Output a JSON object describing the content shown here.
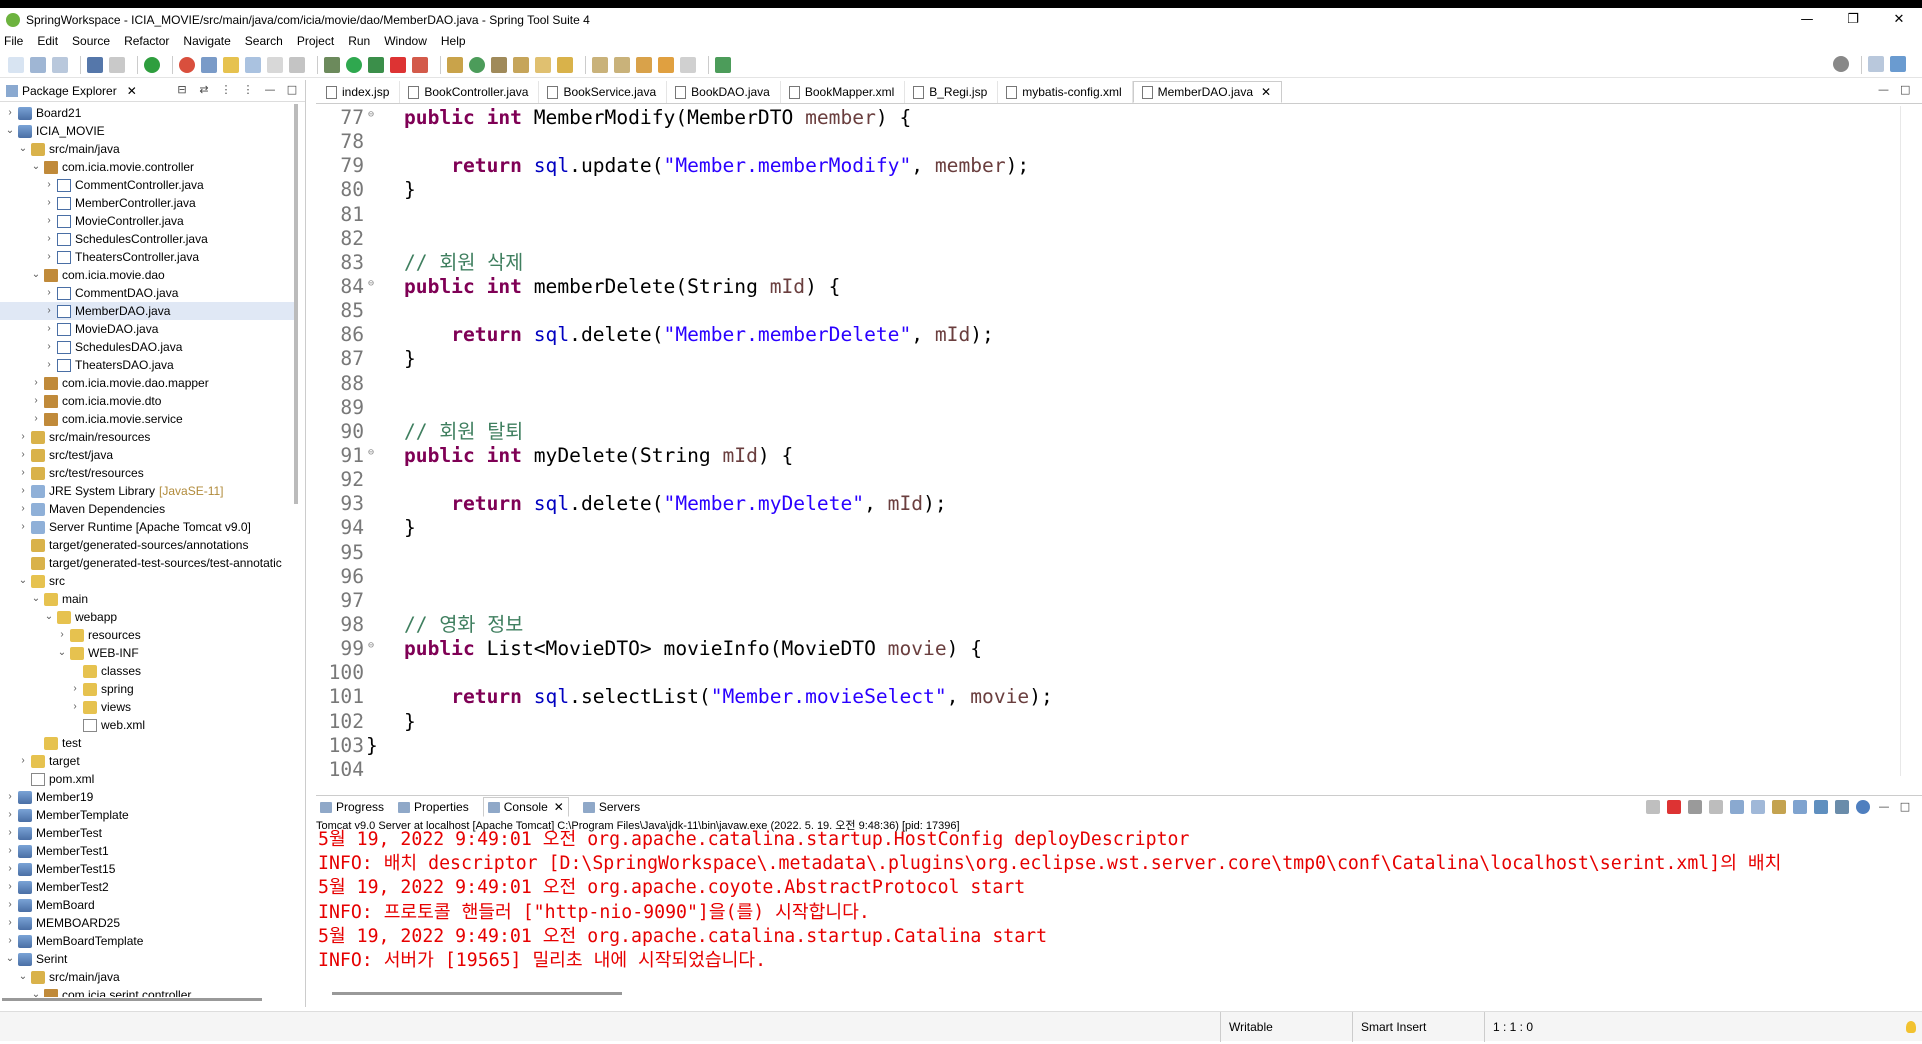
{
  "window": {
    "title": "SpringWorkspace - ICIA_MOVIE/src/main/java/com/icia/movie/dao/MemberDAO.java - Spring Tool Suite 4",
    "controls": [
      "—",
      "❐",
      "✕"
    ]
  },
  "menu": [
    "File",
    "Edit",
    "Source",
    "Refactor",
    "Navigate",
    "Search",
    "Project",
    "Run",
    "Window",
    "Help"
  ],
  "package_explorer": {
    "tab_label": "Package Explorer",
    "tree": [
      {
        "label": "Board21",
        "arrow": "›",
        "icon": "project-icon",
        "indent": 0
      },
      {
        "label": "ICIA_MOVIE",
        "arrow": "⌄",
        "icon": "project-icon",
        "indent": 0
      },
      {
        "label": "src/main/java",
        "arrow": "⌄",
        "icon": "source-folder-icon",
        "indent": 1
      },
      {
        "label": "com.icia.movie.controller",
        "arrow": "⌄",
        "icon": "package-icon",
        "indent": 2
      },
      {
        "label": "CommentController.java",
        "arrow": "›",
        "icon": "java-file-icon",
        "indent": 3
      },
      {
        "label": "MemberController.java",
        "arrow": "›",
        "icon": "java-file-icon",
        "indent": 3
      },
      {
        "label": "MovieController.java",
        "arrow": "›",
        "icon": "java-file-icon",
        "indent": 3
      },
      {
        "label": "SchedulesController.java",
        "arrow": "›",
        "icon": "java-file-icon",
        "indent": 3
      },
      {
        "label": "TheatersController.java",
        "arrow": "›",
        "icon": "java-file-icon",
        "indent": 3
      },
      {
        "label": "com.icia.movie.dao",
        "arrow": "⌄",
        "icon": "package-icon",
        "indent": 2
      },
      {
        "label": "CommentDAO.java",
        "arrow": "›",
        "icon": "java-file-icon",
        "indent": 3
      },
      {
        "label": "MemberDAO.java",
        "arrow": "›",
        "icon": "java-file-icon",
        "indent": 3,
        "selected": true
      },
      {
        "label": "MovieDAO.java",
        "arrow": "›",
        "icon": "java-file-icon",
        "indent": 3
      },
      {
        "label": "SchedulesDAO.java",
        "arrow": "›",
        "icon": "java-file-icon",
        "indent": 3
      },
      {
        "label": "TheatersDAO.java",
        "arrow": "›",
        "icon": "java-file-icon",
        "indent": 3
      },
      {
        "label": "com.icia.movie.dao.mapper",
        "arrow": "›",
        "icon": "package-icon",
        "indent": 2
      },
      {
        "label": "com.icia.movie.dto",
        "arrow": "›",
        "icon": "package-icon",
        "indent": 2
      },
      {
        "label": "com.icia.movie.service",
        "arrow": "›",
        "icon": "package-icon",
        "indent": 2
      },
      {
        "label": "src/main/resources",
        "arrow": "›",
        "icon": "source-folder-icon",
        "indent": 1
      },
      {
        "label": "src/test/java",
        "arrow": "›",
        "icon": "source-folder-icon",
        "indent": 1
      },
      {
        "label": "src/test/resources",
        "arrow": "›",
        "icon": "source-folder-icon",
        "indent": 1
      },
      {
        "label": "JRE System Library",
        "suffix": "[JavaSE-11]",
        "arrow": "›",
        "icon": "library-icon",
        "indent": 1
      },
      {
        "label": "Maven Dependencies",
        "arrow": "›",
        "icon": "library-icon",
        "indent": 1
      },
      {
        "label": "Server Runtime [Apache Tomcat v9.0]",
        "arrow": "›",
        "icon": "library-icon",
        "indent": 1
      },
      {
        "label": "target/generated-sources/annotations",
        "arrow": "",
        "icon": "source-folder-icon",
        "indent": 1
      },
      {
        "label": "target/generated-test-sources/test-annotatic",
        "arrow": "",
        "icon": "source-folder-icon",
        "indent": 1
      },
      {
        "label": "src",
        "arrow": "⌄",
        "icon": "folder-icon",
        "indent": 1
      },
      {
        "label": "main",
        "arrow": "⌄",
        "icon": "folder-icon",
        "indent": 2
      },
      {
        "label": "webapp",
        "arrow": "⌄",
        "icon": "folder-icon",
        "indent": 3
      },
      {
        "label": "resources",
        "arrow": "›",
        "icon": "folder-icon",
        "indent": 4
      },
      {
        "label": "WEB-INF",
        "arrow": "⌄",
        "icon": "folder-icon",
        "indent": 4
      },
      {
        "label": "classes",
        "arrow": "",
        "icon": "folder-icon",
        "indent": 5
      },
      {
        "label": "spring",
        "arrow": "›",
        "icon": "folder-icon",
        "indent": 5
      },
      {
        "label": "views",
        "arrow": "›",
        "icon": "folder-icon",
        "indent": 5
      },
      {
        "label": "web.xml",
        "arrow": "",
        "icon": "xml-file-icon",
        "indent": 5
      },
      {
        "label": "test",
        "arrow": "",
        "icon": "folder-icon",
        "indent": 2
      },
      {
        "label": "target",
        "arrow": "›",
        "icon": "folder-icon",
        "indent": 1
      },
      {
        "label": "pom.xml",
        "arrow": "",
        "icon": "xml-file-icon",
        "indent": 1
      },
      {
        "label": "Member19",
        "arrow": "›",
        "icon": "project-icon",
        "indent": 0
      },
      {
        "label": "MemberTemplate",
        "arrow": "›",
        "icon": "project-icon",
        "indent": 0
      },
      {
        "label": "MemberTest",
        "arrow": "›",
        "icon": "project-icon",
        "indent": 0
      },
      {
        "label": "MemberTest1",
        "arrow": "›",
        "icon": "project-icon",
        "indent": 0
      },
      {
        "label": "MemberTest15",
        "arrow": "›",
        "icon": "project-icon",
        "indent": 0
      },
      {
        "label": "MemberTest2",
        "arrow": "›",
        "icon": "project-icon",
        "indent": 0
      },
      {
        "label": "MemBoard",
        "arrow": "›",
        "icon": "project-icon",
        "indent": 0
      },
      {
        "label": "MEMBOARD25",
        "arrow": "›",
        "icon": "project-icon",
        "indent": 0
      },
      {
        "label": "MemBoardTemplate",
        "arrow": "›",
        "icon": "project-icon",
        "indent": 0
      },
      {
        "label": "Serint",
        "arrow": "⌄",
        "icon": "project-icon",
        "indent": 0
      },
      {
        "label": "src/main/java",
        "arrow": "⌄",
        "icon": "source-folder-icon",
        "indent": 1
      },
      {
        "label": "com.icia.serint.controller",
        "arrow": "⌄",
        "icon": "package-icon",
        "indent": 2
      }
    ]
  },
  "editor": {
    "tabs": [
      {
        "label": "index.jsp"
      },
      {
        "label": "BookController.java"
      },
      {
        "label": "BookService.java"
      },
      {
        "label": "BookDAO.java"
      },
      {
        "label": "BookMapper.xml"
      },
      {
        "label": "B_Regi.jsp"
      },
      {
        "label": "mybatis-config.xml"
      },
      {
        "label": "MemberDAO.java",
        "active": true
      }
    ],
    "lines": [
      {
        "num": "77",
        "fold": true,
        "tokens": [
          [
            "kw",
            "public int "
          ],
          [
            "",
            "MemberModify(MemberDTO "
          ],
          [
            "pv",
            "member"
          ],
          [
            "",
            ") {"
          ]
        ]
      },
      {
        "num": "78",
        "tokens": []
      },
      {
        "num": "79",
        "tokens": [
          [
            "",
            "    "
          ],
          [
            "kw",
            "return "
          ],
          [
            "fld",
            "sql"
          ],
          [
            "",
            ".update("
          ],
          [
            "str",
            "\"Member.memberModify\""
          ],
          [
            "",
            ", "
          ],
          [
            "pv",
            "member"
          ],
          [
            "",
            ");"
          ]
        ]
      },
      {
        "num": "80",
        "tokens": [
          [
            "",
            "}"
          ]
        ]
      },
      {
        "num": "81",
        "tokens": []
      },
      {
        "num": "82",
        "tokens": []
      },
      {
        "num": "83",
        "tokens": [
          [
            "cm",
            "// 회원 삭제"
          ]
        ]
      },
      {
        "num": "84",
        "fold": true,
        "tokens": [
          [
            "kw",
            "public int "
          ],
          [
            "",
            "memberDelete(String "
          ],
          [
            "pv",
            "mId"
          ],
          [
            "",
            ") {"
          ]
        ]
      },
      {
        "num": "85",
        "tokens": []
      },
      {
        "num": "86",
        "tokens": [
          [
            "",
            "    "
          ],
          [
            "kw",
            "return "
          ],
          [
            "fld",
            "sql"
          ],
          [
            "",
            ".delete("
          ],
          [
            "str",
            "\"Member.memberDelete\""
          ],
          [
            "",
            ", "
          ],
          [
            "pv",
            "mId"
          ],
          [
            "",
            ");"
          ]
        ]
      },
      {
        "num": "87",
        "tokens": [
          [
            "",
            "}"
          ]
        ]
      },
      {
        "num": "88",
        "tokens": []
      },
      {
        "num": "89",
        "tokens": []
      },
      {
        "num": "90",
        "tokens": [
          [
            "cm",
            "// 회원 탈퇴"
          ]
        ]
      },
      {
        "num": "91",
        "fold": true,
        "tokens": [
          [
            "kw",
            "public int "
          ],
          [
            "",
            "myDelete(String "
          ],
          [
            "pv",
            "mId"
          ],
          [
            "",
            ") {"
          ]
        ]
      },
      {
        "num": "92",
        "tokens": []
      },
      {
        "num": "93",
        "tokens": [
          [
            "",
            "    "
          ],
          [
            "kw",
            "return "
          ],
          [
            "fld",
            "sql"
          ],
          [
            "",
            ".delete("
          ],
          [
            "str",
            "\"Member.myDelete\""
          ],
          [
            "",
            ", "
          ],
          [
            "pv",
            "mId"
          ],
          [
            "",
            ");"
          ]
        ]
      },
      {
        "num": "94",
        "tokens": [
          [
            "",
            "}"
          ]
        ]
      },
      {
        "num": "95",
        "tokens": []
      },
      {
        "num": "96",
        "tokens": []
      },
      {
        "num": "97",
        "tokens": []
      },
      {
        "num": "98",
        "tokens": [
          [
            "cm",
            "// 영화 정보"
          ]
        ]
      },
      {
        "num": "99",
        "fold": true,
        "tokens": [
          [
            "kw",
            "public "
          ],
          [
            "",
            "List<MovieDTO> movieInfo(MovieDTO "
          ],
          [
            "pv",
            "movie"
          ],
          [
            "",
            ") {"
          ]
        ]
      },
      {
        "num": "100",
        "tokens": []
      },
      {
        "num": "101",
        "tokens": [
          [
            "",
            "    "
          ],
          [
            "kw",
            "return "
          ],
          [
            "fld",
            "sql"
          ],
          [
            "",
            ".selectList("
          ],
          [
            "str",
            "\"Member.movieSelect\""
          ],
          [
            "",
            ", "
          ],
          [
            "pv",
            "movie"
          ],
          [
            "",
            ");"
          ]
        ]
      },
      {
        "num": "102",
        "tokens": [
          [
            "",
            "}"
          ]
        ]
      },
      {
        "num": "103",
        "outdent": true,
        "tokens": [
          [
            "",
            "}"
          ]
        ]
      },
      {
        "num": "104",
        "tokens": []
      }
    ]
  },
  "console": {
    "tabs": [
      {
        "label": "Progress"
      },
      {
        "label": "Properties"
      },
      {
        "label": "Console",
        "active": true
      },
      {
        "label": "Servers"
      }
    ],
    "header": "Tomcat v9.0 Server at localhost [Apache Tomcat] C:\\Program Files\\Java\\jdk-11\\bin\\javaw.exe  (2022. 5. 19. 오전 9:48:36) [pid: 17396]",
    "lines": [
      "5월 19, 2022 9:49:01 오전 org.apache.catalina.startup.HostConfig deployDescriptor",
      "INFO: 배치 descriptor [D:\\SpringWorkspace\\.metadata\\.plugins\\org.eclipse.wst.server.core\\tmp0\\conf\\Catalina\\localhost\\serint.xml]의 배치",
      "5월 19, 2022 9:49:01 오전 org.apache.coyote.AbstractProtocol start",
      "INFO: 프로토콜 핸들러 [\"http-nio-9090\"]을(를) 시작합니다.",
      "5월 19, 2022 9:49:01 오전 org.apache.catalina.startup.Catalina start",
      "INFO: 서버가 [19565] 밀리초 내에 시작되었습니다."
    ]
  },
  "status": {
    "mode": "Writable",
    "insert": "Smart Insert",
    "position": "1 : 1 : 0"
  },
  "colors": {
    "keyword": "#7f0055",
    "string": "#2a00ff",
    "comment": "#3f7f5f",
    "field": "#0000c0",
    "console_error": "#e60000"
  }
}
